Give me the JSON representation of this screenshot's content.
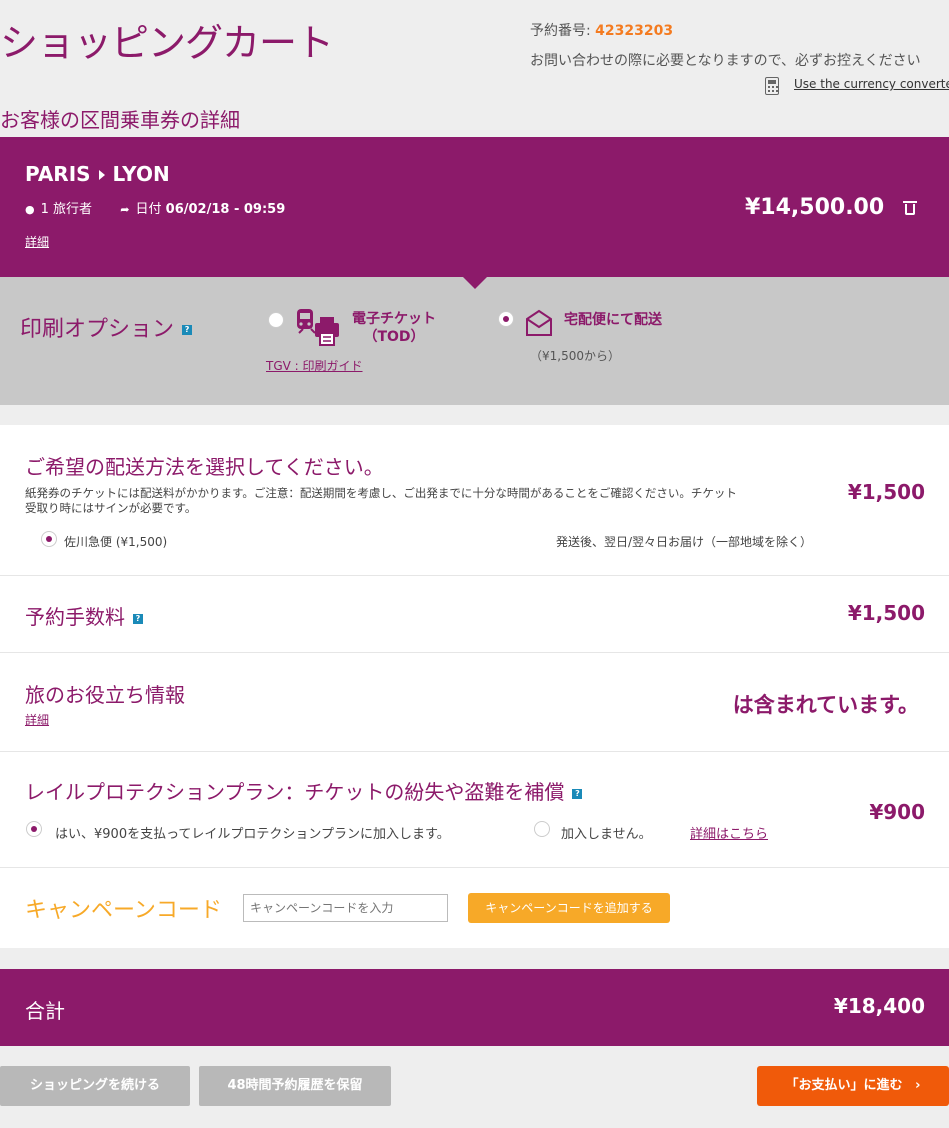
{
  "header": {
    "title": "ショッピングカート",
    "reservation_label": "予約番号:",
    "reservation_number": "42323203",
    "notice": "お問い合わせの際に必要となりますので、必ずお控えください",
    "currency_link": "Use the currency converter",
    "subtitle": "お客様の区間乗車券の詳細"
  },
  "trip": {
    "origin": "PARIS",
    "destination": "LYON",
    "travellers": "1 旅行者",
    "date_label": "日付",
    "date": "06/02/18 - 09:59",
    "detail_link": "詳細",
    "price": "¥14,500.00"
  },
  "print_options": {
    "label": "印刷オプション",
    "help": "?",
    "eticket_label": "電子チケット（TOD）",
    "eticket_selected": false,
    "guide_link": "TGV : 印刷ガイド",
    "delivery_label": "宅配便にて配送",
    "delivery_selected": true,
    "delivery_from": "（¥1,500から）"
  },
  "shipping": {
    "heading": "ご希望の配送方法を選択してください。",
    "desc": "紙発券のチケットには配送料がかかります。ご注意：配送期間を考慮し、ご出発までに十分な時間があることをご確認ください。チケット受取り時にはサインが必要です。",
    "method": "佐川急便 (¥1,500)",
    "method_note": "発送後、翌日/翌々日お届け（一部地域を除く）",
    "price": "¥1,500"
  },
  "fee": {
    "label": "予約手数料",
    "help": "?",
    "price": "¥1,500"
  },
  "travel_info": {
    "label": "旅のお役立ち情報",
    "detail_link": "詳細",
    "included": "は含まれています。"
  },
  "protection": {
    "heading": "レイルプロテクションプラン：チケットの紛失や盗難を補償",
    "help": "?",
    "yes_label": "はい、¥900を支払ってレイルプロテクションプランに加入します。",
    "yes_selected": true,
    "no_label": "加入しません。",
    "detail_link": "詳細はこちら",
    "price": "¥900"
  },
  "campaign": {
    "label": "キャンペーンコード",
    "placeholder": "キャンペーンコードを入力",
    "button": "キャンペーンコードを追加する"
  },
  "total": {
    "label": "合計",
    "value": "¥18,400"
  },
  "footer": {
    "continue_button": "ショッピングを続ける",
    "hold_button": "48時間予約履歴を保留",
    "pay_button": "「お支払い」に進む"
  },
  "colors": {
    "brand": "#8c1a6a",
    "accent": "#f47b20",
    "campaign": "#f7a928",
    "pay": "#f05a0a"
  }
}
